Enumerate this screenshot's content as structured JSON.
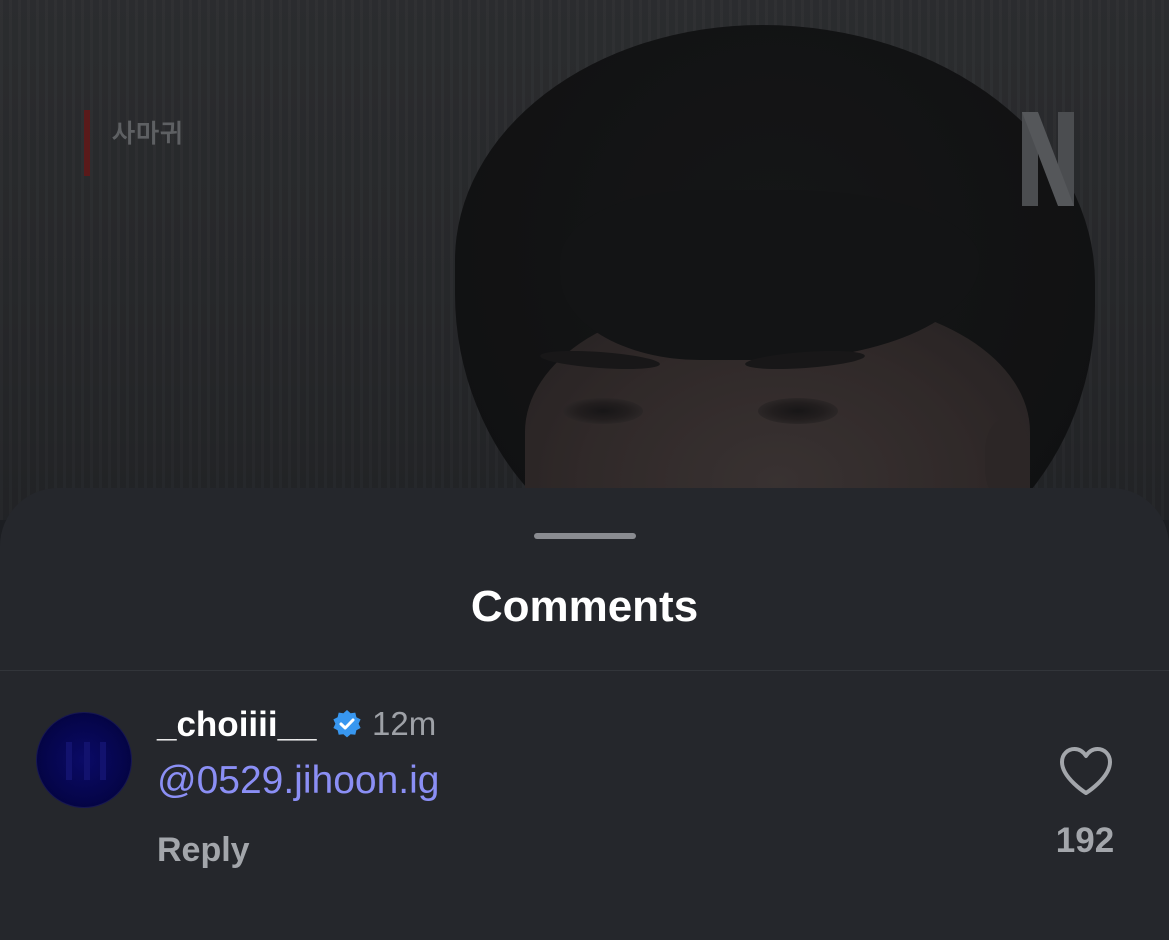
{
  "video": {
    "title_mark": "사마귀",
    "logo": "N",
    "logo_icon": "netflix-n-logo"
  },
  "sheet": {
    "title": "Comments"
  },
  "comment": {
    "username": "_choiiii__",
    "verified_icon": "verified-badge-icon",
    "time": "12m",
    "text": "@0529.jihoon.ig",
    "reply_label": "Reply",
    "like_icon": "heart-icon",
    "like_count": "192"
  },
  "colors": {
    "sheet_bg": "#25272c",
    "mention": "#8b8ff5",
    "verified": "#3897f0"
  }
}
